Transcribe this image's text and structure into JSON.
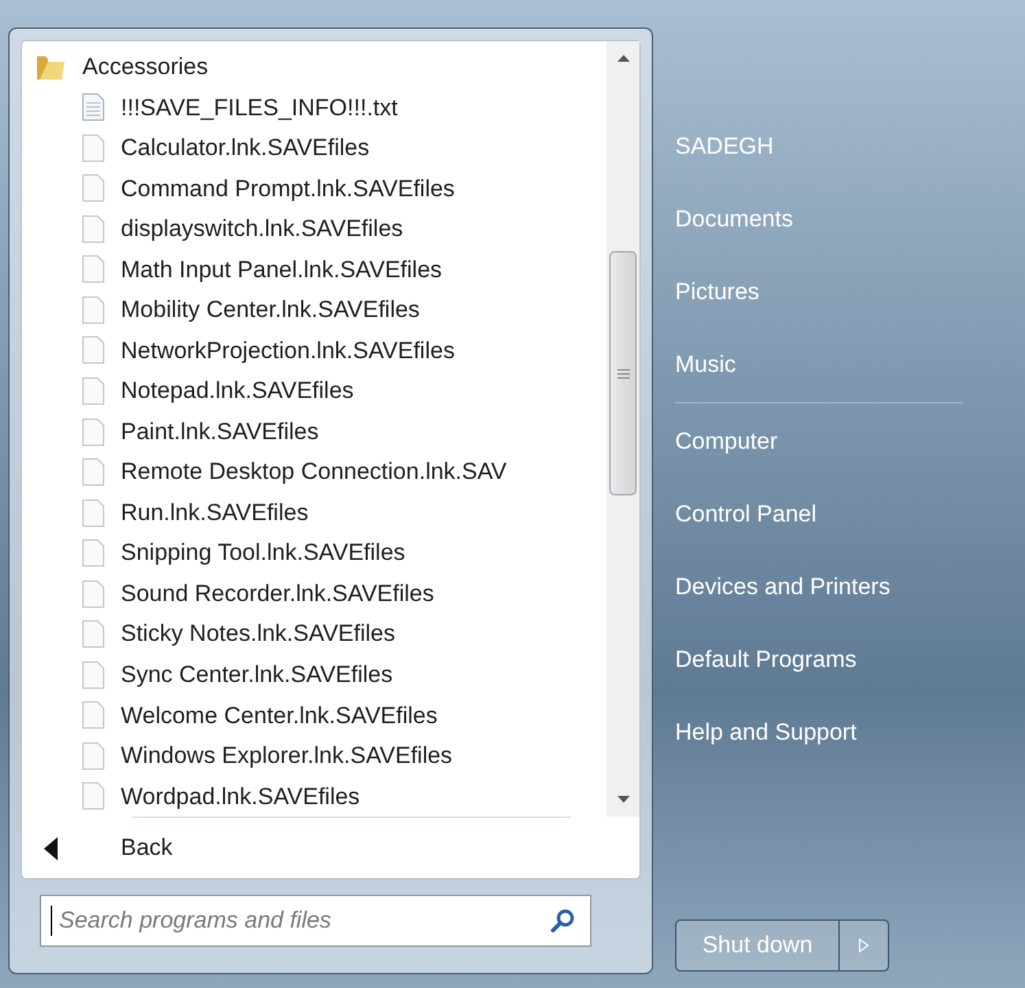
{
  "programs": {
    "folder": {
      "label": "Accessories",
      "kind": "folder",
      "expanded": true,
      "children": [
        {
          "label": "!!!SAVE_FILES_INFO!!!.txt",
          "kind": "text"
        },
        {
          "label": "Calculator.lnk.SAVEfiles",
          "kind": "file"
        },
        {
          "label": "Command Prompt.lnk.SAVEfiles",
          "kind": "file"
        },
        {
          "label": "displayswitch.lnk.SAVEfiles",
          "kind": "file"
        },
        {
          "label": "Math Input Panel.lnk.SAVEfiles",
          "kind": "file"
        },
        {
          "label": "Mobility Center.lnk.SAVEfiles",
          "kind": "file"
        },
        {
          "label": "NetworkProjection.lnk.SAVEfiles",
          "kind": "file"
        },
        {
          "label": "Notepad.lnk.SAVEfiles",
          "kind": "file"
        },
        {
          "label": "Paint.lnk.SAVEfiles",
          "kind": "file"
        },
        {
          "label": "Remote Desktop Connection.lnk.SAV",
          "kind": "file"
        },
        {
          "label": "Run.lnk.SAVEfiles",
          "kind": "file"
        },
        {
          "label": "Snipping Tool.lnk.SAVEfiles",
          "kind": "file"
        },
        {
          "label": "Sound Recorder.lnk.SAVEfiles",
          "kind": "file"
        },
        {
          "label": "Sticky Notes.lnk.SAVEfiles",
          "kind": "file"
        },
        {
          "label": "Sync Center.lnk.SAVEfiles",
          "kind": "file"
        },
        {
          "label": "Welcome Center.lnk.SAVEfiles",
          "kind": "file"
        },
        {
          "label": "Windows Explorer.lnk.SAVEfiles",
          "kind": "file"
        },
        {
          "label": "Wordpad.lnk.SAVEfiles",
          "kind": "file"
        }
      ]
    },
    "back": "Back"
  },
  "search": {
    "placeholder": "Search programs and files"
  },
  "places": [
    [
      "SADEGH",
      "Documents",
      "Pictures",
      "Music"
    ],
    [
      "Computer",
      "Control Panel",
      "Devices and Printers",
      "Default Programs",
      "Help and Support"
    ]
  ],
  "shutdown": {
    "label": "Shut down"
  }
}
